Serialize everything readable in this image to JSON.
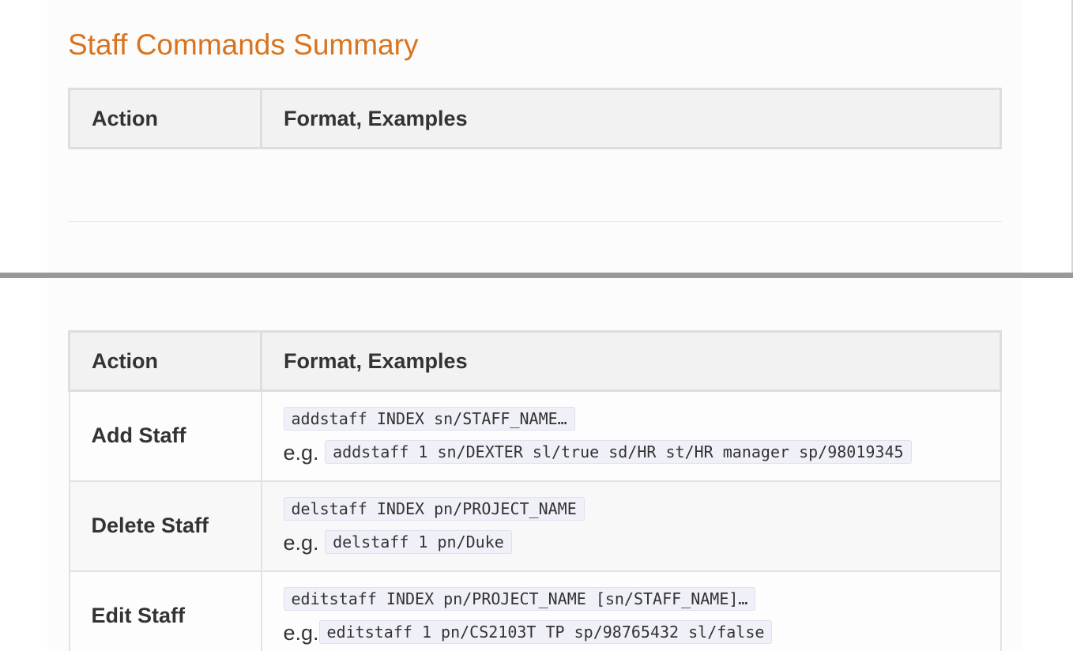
{
  "title": "Staff Commands Summary",
  "columns": {
    "action": "Action",
    "format": "Format, Examples"
  },
  "commands": [
    {
      "action": "Add Staff",
      "format": "addstaff INDEX sn/STAFF_NAME…",
      "eg_prefix": "e.g.",
      "example": "addstaff 1 sn/DEXTER sl/true sd/HR st/HR manager sp/98019345"
    },
    {
      "action": "Delete Staff",
      "format": "delstaff INDEX pn/PROJECT_NAME",
      "eg_prefix": "e.g.",
      "example": "delstaff 1 pn/Duke"
    },
    {
      "action": "Edit Staff",
      "format": "editstaff INDEX pn/PROJECT_NAME [sn/STAFF_NAME]…",
      "eg_prefix": "e.g.",
      "example": "editstaff 1 pn/CS2103T TP sp/98765432 sl/false"
    }
  ]
}
